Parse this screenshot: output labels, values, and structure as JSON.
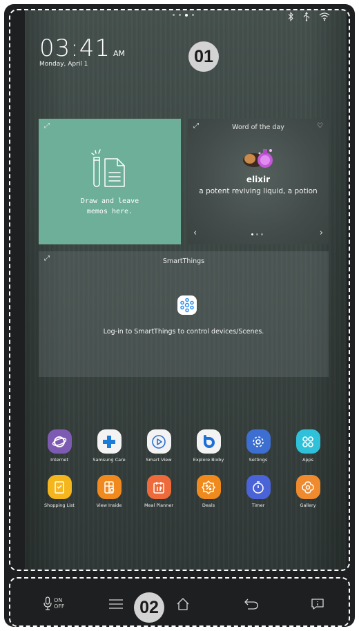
{
  "status": {
    "page_dots": 4,
    "active_dot": 2,
    "icons": [
      "bluetooth-icon",
      "usb-icon",
      "wifi-icon"
    ]
  },
  "clock": {
    "time": "03:41",
    "ampm": "AM",
    "date": "Monday, April 1"
  },
  "callouts": {
    "first": "01",
    "second": "02"
  },
  "memo_widget": {
    "text_line1": "Draw and leave",
    "text_line2": "memos here.",
    "background": "#6daf98"
  },
  "word_widget": {
    "title": "Word of the day",
    "term": "elixir",
    "definition": "a potent reviving liquid, a potion",
    "prev": "‹",
    "next": "›"
  },
  "smartthings_widget": {
    "title": "SmartThings",
    "message": "Log-in to SmartThings to control devices/Scenes."
  },
  "apps": [
    {
      "label": "Internet",
      "color": "#7e5bb3",
      "icon": "internet-icon"
    },
    {
      "label": "Samsung Care",
      "color": "#f3f3f3",
      "icon": "samsung-care-icon"
    },
    {
      "label": "Smart View",
      "color": "#f3f3f3",
      "icon": "smart-view-icon"
    },
    {
      "label": "Explore Bixby",
      "color": "#f3f3f3",
      "icon": "bixby-icon"
    },
    {
      "label": "Settings",
      "color": "#3c6fd1",
      "icon": "settings-icon"
    },
    {
      "label": "Apps",
      "color": "#2fc1d9",
      "icon": "apps-icon"
    },
    {
      "label": "Shopping List",
      "color": "#f5b51c",
      "icon": "shopping-list-icon"
    },
    {
      "label": "View Inside",
      "color": "#f08a1e",
      "icon": "view-inside-icon"
    },
    {
      "label": "Meal Planner",
      "color": "#ef6a3a",
      "icon": "meal-planner-icon"
    },
    {
      "label": "Deals",
      "color": "#f18a1c",
      "icon": "deals-icon"
    },
    {
      "label": "Timer",
      "color": "#4a63d6",
      "icon": "timer-icon"
    },
    {
      "label": "Gallery",
      "color": "#f08a2e",
      "icon": "gallery-icon"
    }
  ],
  "navbar": {
    "mic_on": "ON",
    "mic_off": "OFF"
  }
}
